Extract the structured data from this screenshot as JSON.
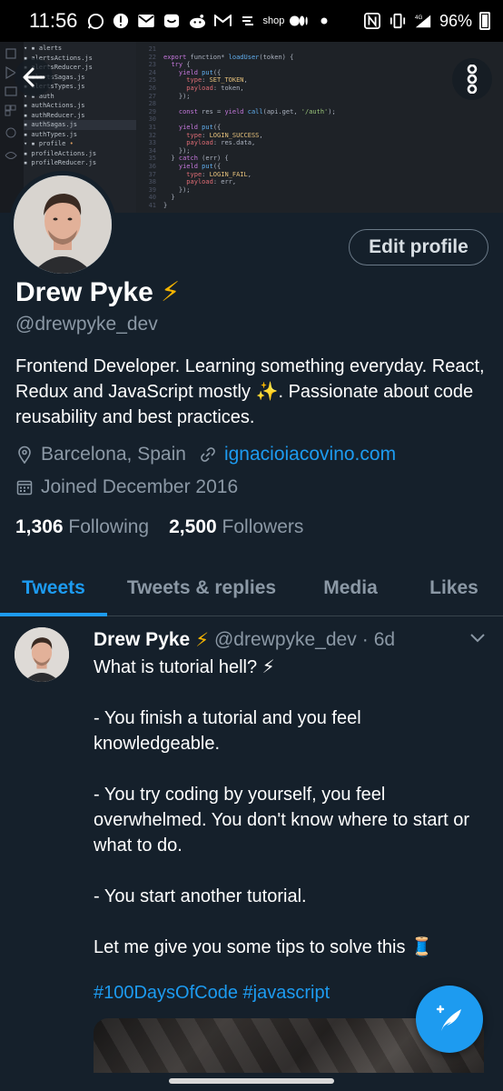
{
  "status_bar": {
    "time": "11:56",
    "shop_label": "shop",
    "network_label": "4G",
    "battery": "96%",
    "battery_level": 0.96
  },
  "banner": {
    "tree": [
      {
        "label": "alerts",
        "type": "folder"
      },
      {
        "label": "alertsActions.js",
        "type": "file"
      },
      {
        "label": "alertsReducer.js",
        "type": "file"
      },
      {
        "label": "alertsSagas.js",
        "type": "file"
      },
      {
        "label": "alertsTypes.js",
        "type": "file"
      },
      {
        "label": "auth",
        "type": "folder"
      },
      {
        "label": "authActions.js",
        "type": "file"
      },
      {
        "label": "authReducer.js",
        "type": "file"
      },
      {
        "label": "authSagas.js",
        "type": "file",
        "selected": true
      },
      {
        "label": "authTypes.js",
        "type": "file"
      },
      {
        "label": "profile",
        "type": "folder",
        "modified": true
      },
      {
        "label": "profileActions.js",
        "type": "file"
      },
      {
        "label": "profileReducer.js",
        "type": "file"
      }
    ],
    "line_numbers": [
      "21",
      "22",
      "23",
      "24",
      "25",
      "26",
      "27",
      "28",
      "29",
      "30",
      "31",
      "32",
      "33",
      "34",
      "35",
      "36",
      "37",
      "38",
      "39",
      "40",
      "41"
    ],
    "code": [
      "",
      "export function* loadUser(token) {",
      "  try {",
      "    yield put({",
      "      type: SET_TOKEN,",
      "      payload: token,",
      "    });",
      "",
      "    const res = yield call(api.get, '/auth');",
      "",
      "    yield put({",
      "      type: LOGIN_SUCCESS,",
      "      payload: res.data,",
      "    });",
      "  } catch (err) {",
      "    yield put({",
      "      type: LOGIN_FAIL,",
      "      payload: err,",
      "    });",
      "  }",
      "}"
    ]
  },
  "profile": {
    "name": "Drew Pyke",
    "name_emoji": "⚡",
    "handle": "@drewpyke_dev",
    "edit_button": "Edit profile",
    "bio": "Frontend Developer. Learning something everyday. React, Redux and JavaScript mostly ✨. Passionate about code reusability and best practices.",
    "location": "Barcelona, Spain",
    "website": "ignacioiacovino.com",
    "joined": "Joined December 2016",
    "following_count": "1,306",
    "following_label": "Following",
    "followers_count": "2,500",
    "followers_label": "Followers"
  },
  "tabs": [
    {
      "label": "Tweets",
      "active": true
    },
    {
      "label": "Tweets & replies",
      "active": false
    },
    {
      "label": "Media",
      "active": false
    },
    {
      "label": "Likes",
      "active": false
    }
  ],
  "tweet": {
    "author": "Drew Pyke",
    "author_emoji": "⚡",
    "handle": "@drewpyke_dev",
    "separator": "·",
    "time": "6d",
    "lines": [
      "What is tutorial hell? ⚡",
      "- You finish a tutorial and you feel knowledgeable.",
      "- You try coding by yourself, you feel overwhelmed. You don't know where to start or what to do.",
      "- You start another tutorial.",
      "Let me give you some tips to solve this 🧵"
    ],
    "hashtags": "#100DaysOfCode #javascript"
  },
  "colors": {
    "background": "#15202b",
    "accent": "#1d9bf0",
    "secondary_text": "#8b98a5",
    "bolt": "#f5b400"
  },
  "icons": {
    "back": "arrow-left-icon",
    "more": "more-vertical-icon",
    "location": "location-pin-icon",
    "link": "link-icon",
    "calendar": "calendar-icon",
    "chevron": "chevron-down-icon",
    "compose": "compose-tweet-icon"
  }
}
